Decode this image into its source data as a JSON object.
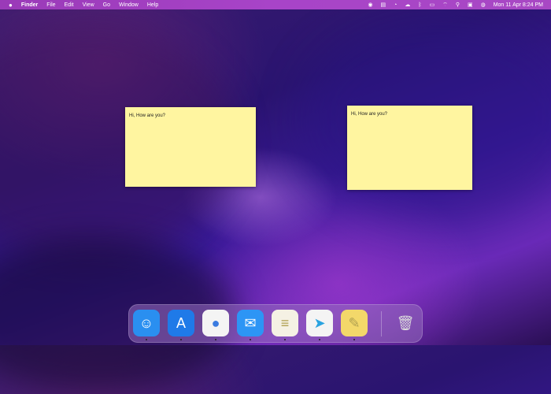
{
  "menubar": {
    "apple": "",
    "app_name": "Finder",
    "items": [
      "File",
      "Edit",
      "View",
      "Go",
      "Window",
      "Help"
    ],
    "clock": "Mon 11 Apr  8:24 PM"
  },
  "notes": [
    {
      "text": "Hi, How are you?"
    },
    {
      "text": "Hi, How are you?"
    }
  ],
  "dock": {
    "apps": [
      {
        "name": "Finder",
        "icon": "finder-icon",
        "glyph": "☺",
        "color": "#2a8ff0",
        "running": true
      },
      {
        "name": "App Store",
        "icon": "app-store-icon",
        "glyph": "A",
        "color": "#1f7ae8",
        "running": true
      },
      {
        "name": "Google Chrome",
        "icon": "chrome-icon",
        "glyph": "●",
        "color": "#f4f4f4",
        "running": true
      },
      {
        "name": "Mail",
        "icon": "mail-icon",
        "glyph": "✉",
        "color": "#2d95f5",
        "running": true
      },
      {
        "name": "Notes",
        "icon": "notes-icon",
        "glyph": "≡",
        "color": "#f5f1e4",
        "running": true
      },
      {
        "name": "Telegram",
        "icon": "telegram-icon",
        "glyph": "➤",
        "color": "#f4f4f4",
        "running": true
      },
      {
        "name": "Stickies",
        "icon": "stickies-icon",
        "glyph": "✎",
        "color": "#f3d86a",
        "running": true
      }
    ],
    "trash": {
      "name": "Trash",
      "glyph": "🗑"
    }
  }
}
